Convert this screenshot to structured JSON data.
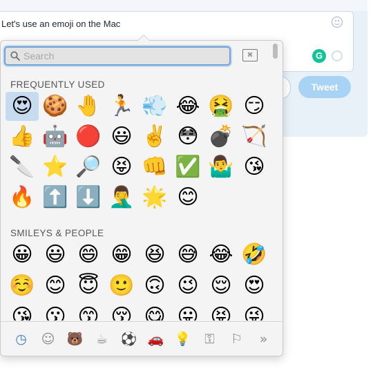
{
  "composer": {
    "text": "Let's use an emoji on the Mac",
    "tweet_label": "Tweet",
    "grammarly_label": "G"
  },
  "picker": {
    "search_placeholder": "Search",
    "sections": {
      "frequently_used": {
        "title": "FREQUENTLY USED",
        "rows": [
          [
            "😍",
            "🍪",
            "🤚",
            "🏃",
            "💨",
            "😂",
            "🤮",
            "😏"
          ],
          [
            "👍",
            "🤖",
            "🔴",
            "😃",
            "✌️",
            "😳",
            "💣",
            "🏹"
          ],
          [
            "🔪",
            "⭐",
            "🔎",
            "😝",
            "👊",
            "✅",
            "🤷‍♂️",
            "😘"
          ],
          [
            "🔥",
            "⬆️",
            "⬇️",
            "🤦‍♂️",
            "🌟",
            "😊"
          ]
        ]
      },
      "smileys_people": {
        "title": "SMILEYS & PEOPLE",
        "rows": [
          [
            "😀",
            "😃",
            "😄",
            "😁",
            "😆",
            "😅",
            "😂",
            "🤣"
          ],
          [
            "☺️",
            "😊",
            "😇",
            "🙂",
            "🙃",
            "😉",
            "😌",
            "😍"
          ],
          [
            "😘",
            "😗",
            "😙",
            "😚",
            "😋",
            "😛",
            "😝",
            "😜"
          ]
        ]
      }
    },
    "categories": [
      {
        "name": "clock-icon",
        "glyph": "◷"
      },
      {
        "name": "smiley-icon",
        "glyph": "☺"
      },
      {
        "name": "animal-icon",
        "glyph": "🐻"
      },
      {
        "name": "food-icon",
        "glyph": "☕"
      },
      {
        "name": "activity-icon",
        "glyph": "⚽"
      },
      {
        "name": "travel-icon",
        "glyph": "🚗"
      },
      {
        "name": "objects-icon",
        "glyph": "💡"
      },
      {
        "name": "symbols-icon",
        "glyph": "⚿"
      },
      {
        "name": "flag-icon",
        "glyph": "⚐"
      },
      {
        "name": "more-icon",
        "glyph": "»"
      }
    ]
  }
}
